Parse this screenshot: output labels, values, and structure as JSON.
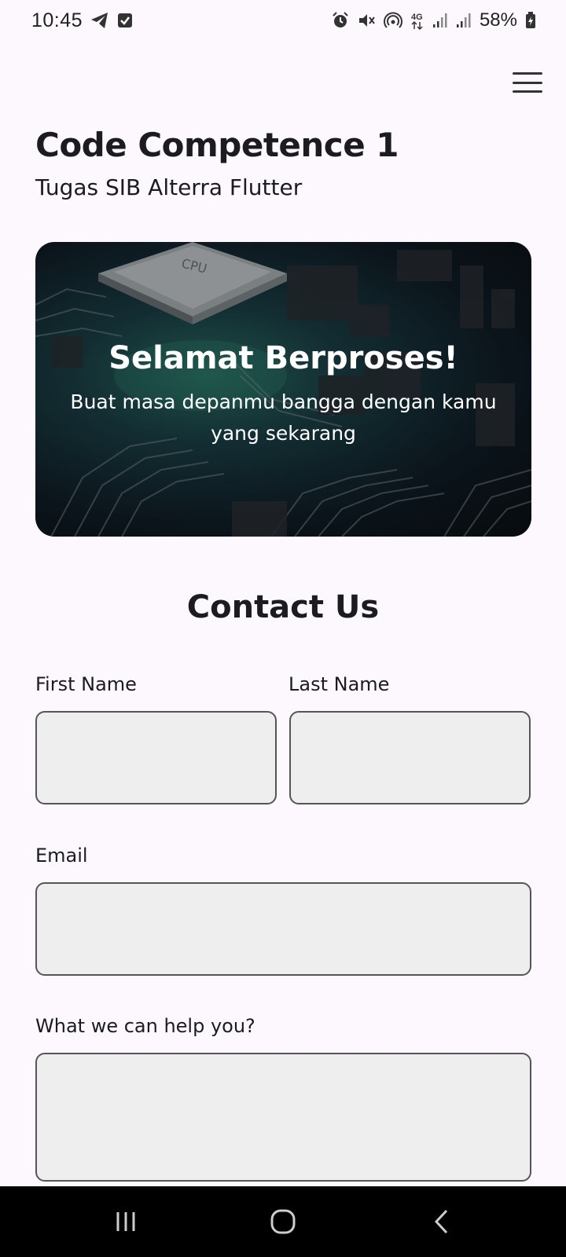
{
  "status_bar": {
    "time": "10:45",
    "battery": "58%",
    "left_icons": [
      "telegram-icon",
      "checkbox-notification-icon"
    ],
    "right_icons": [
      "alarm-icon",
      "vibrate-mute-icon",
      "hotspot-icon",
      "4g-data-icon",
      "signal-icon",
      "signal-icon",
      "battery-icon"
    ]
  },
  "app": {
    "menu_icon": "hamburger-menu-icon",
    "title": "Code Competence 1",
    "subtitle": "Tugas SIB Alterra Flutter"
  },
  "banner": {
    "title": "Selamat Berproses!",
    "text": "Buat masa depanmu bangga dengan kamu yang sekarang",
    "image": "circuit-board-cpu-image"
  },
  "contact": {
    "title": "Contact Us",
    "first_name_label": "First Name",
    "first_name_value": "",
    "last_name_label": "Last Name",
    "last_name_value": "",
    "email_label": "Email",
    "email_value": "",
    "message_label": "What we can help you?",
    "message_value": ""
  },
  "nav_bar": {
    "recents_icon": "recent-apps-icon",
    "home_icon": "home-icon",
    "back_icon": "back-icon"
  },
  "colors": {
    "background": "#fdf8fd",
    "input_fill": "#eeeeee",
    "input_border": "#555555",
    "text": "#1c1b1f",
    "nav_bar": "#000000"
  }
}
